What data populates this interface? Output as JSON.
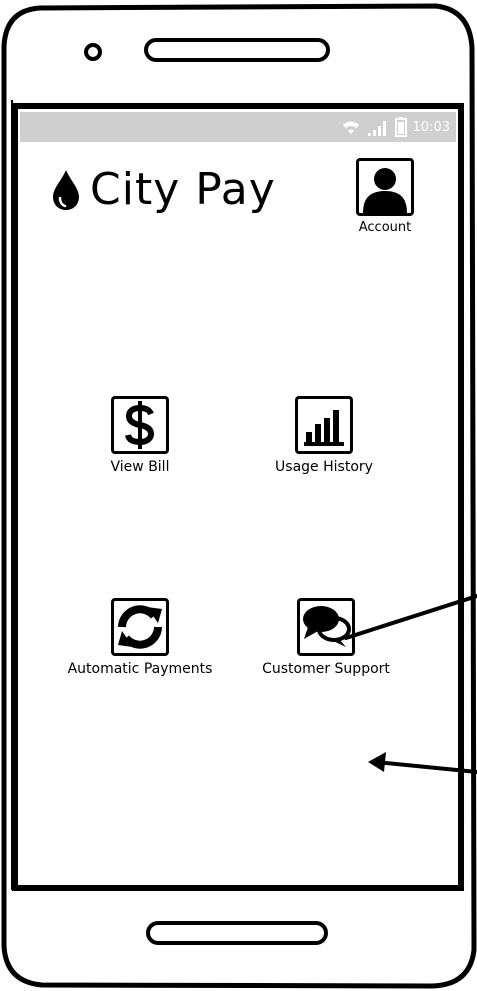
{
  "status_bar": {
    "time": "10:03",
    "icons": [
      "wifi-icon",
      "signal-icon",
      "battery-icon"
    ],
    "background": "#cfcfcf"
  },
  "header": {
    "title": "City Pay",
    "logo_icon": "water-drop-icon"
  },
  "account": {
    "label": "Account",
    "icon": "user-icon"
  },
  "tiles": [
    {
      "label": "View Bill",
      "icon": "dollar-icon"
    },
    {
      "label": "Usage History",
      "icon": "bar-chart-icon"
    },
    {
      "label": "Automatic Payments",
      "icon": "refresh-icon"
    },
    {
      "label": "Customer Support",
      "icon": "chat-bubbles-icon"
    }
  ]
}
